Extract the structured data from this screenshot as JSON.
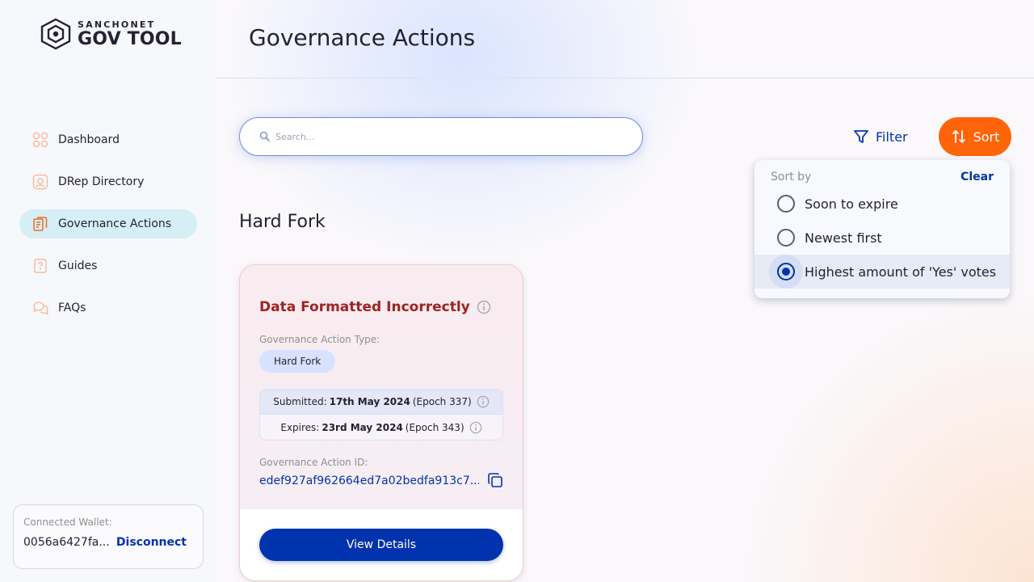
{
  "brand": {
    "sub": "SANCHONET",
    "main": "GOV TOOL"
  },
  "nav": {
    "items": [
      {
        "label": "Dashboard",
        "icon": "dashboard-icon"
      },
      {
        "label": "DRep Directory",
        "icon": "drep-directory-icon"
      },
      {
        "label": "Governance Actions",
        "icon": "governance-actions-icon",
        "active": true
      },
      {
        "label": "Guides",
        "icon": "guides-icon"
      },
      {
        "label": "FAQs",
        "icon": "faqs-icon"
      }
    ]
  },
  "wallet": {
    "label": "Connected Wallet:",
    "address": "0056a6427fa...",
    "disconnect": "Disconnect"
  },
  "header": {
    "title": "Governance Actions"
  },
  "search": {
    "placeholder": "Search..."
  },
  "toolbar": {
    "filter_label": "Filter",
    "sort_label": "Sort"
  },
  "sort_menu": {
    "title": "Sort by",
    "clear": "Clear",
    "options": [
      {
        "label": "Soon to expire",
        "selected": false
      },
      {
        "label": "Newest first",
        "selected": false
      },
      {
        "label": "Highest amount of 'Yes' votes",
        "selected": true
      }
    ]
  },
  "section": {
    "title": "Hard Fork"
  },
  "card": {
    "title": "Data Formatted Incorrectly",
    "type_label": "Governance Action Type:",
    "type_value": "Hard Fork",
    "submitted_label": "Submitted:",
    "submitted_date": "17th May 2024",
    "submitted_epoch": "(Epoch 337)",
    "expires_label": "Expires:",
    "expires_date": "23rd May 2024",
    "expires_epoch": "(Epoch 343)",
    "id_label": "Governance Action ID:",
    "id_value": "edef927af962664ed7a02bedfa913c7...",
    "view_button": "View Details"
  },
  "colors": {
    "primary": "#0033ad",
    "accent": "#ff640a",
    "error_title": "#9e2323",
    "nav_active_bg": "#d6eff6"
  }
}
